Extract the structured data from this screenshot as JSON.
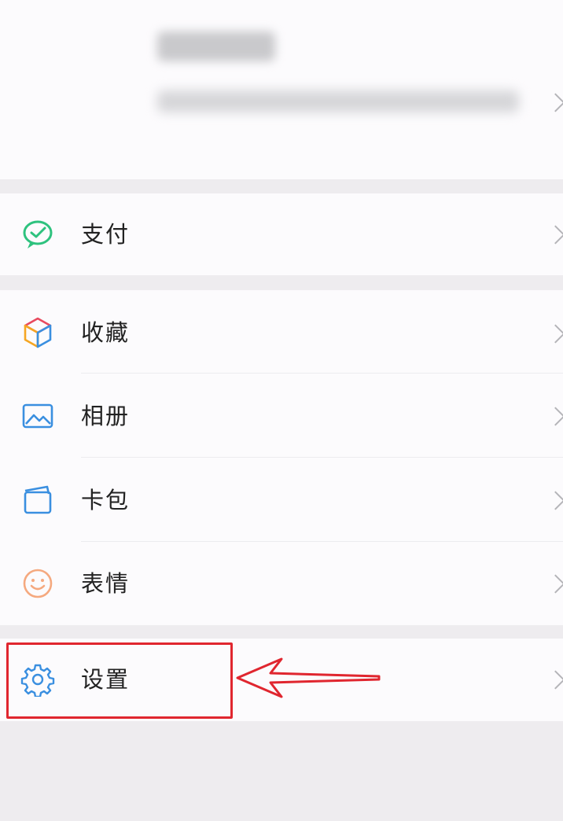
{
  "profile": {
    "name_label": "",
    "wechat_id_label": ""
  },
  "menu": {
    "pay": {
      "label": "支付",
      "icon": "wechat-pay-icon"
    },
    "favorites": {
      "label": "收藏",
      "icon": "cube-icon"
    },
    "album": {
      "label": "相册",
      "icon": "photo-icon"
    },
    "cards": {
      "label": "卡包",
      "icon": "wallet-icon"
    },
    "stickers": {
      "label": "表情",
      "icon": "smile-icon"
    },
    "settings": {
      "label": "设置",
      "icon": "gear-icon"
    }
  },
  "colors": {
    "highlight": "#e0262f",
    "pay_green": "#2ec27e",
    "settings_blue": "#3a8fe0"
  }
}
